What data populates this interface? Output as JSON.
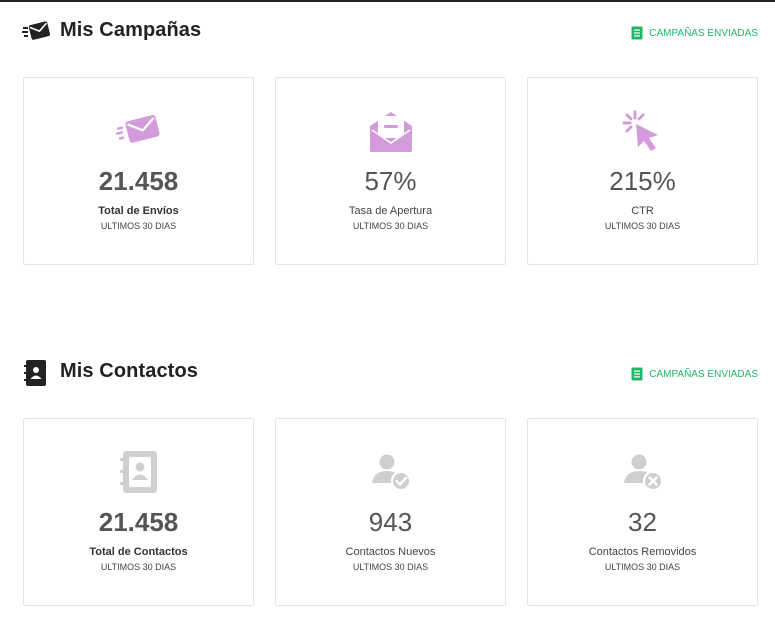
{
  "campaigns": {
    "title": "Mis Campañas",
    "link_label": "CAMPAÑAS ENVIADAS",
    "cards": [
      {
        "value": "21.458",
        "label": "Total de Envíos",
        "sub": "ULTIMOS 30 DIAS",
        "icon": "sent-envelope-icon"
      },
      {
        "value": "57%",
        "label": "Tasa de Apertura",
        "sub": "ULTIMOS 30 DIAS",
        "icon": "open-envelope-icon"
      },
      {
        "value": "215%",
        "label": "CTR",
        "sub": "ULTIMOS 30 DIAS",
        "icon": "click-cursor-icon"
      }
    ]
  },
  "contacts": {
    "title": "Mis Contactos",
    "link_label": "CAMPAÑAS ENVIADAS",
    "cards": [
      {
        "value": "21.458",
        "label": "Total de Contactos",
        "sub": "ULTIMOS 30 DIAS",
        "icon": "address-book-icon"
      },
      {
        "value": "943",
        "label": "Contactos Nuevos",
        "sub": "ULTIMOS 30 DIAS",
        "icon": "user-check-icon"
      },
      {
        "value": "32",
        "label": "Contactos Removidos",
        "sub": "ULTIMOS 30 DIAS",
        "icon": "user-remove-icon"
      }
    ]
  },
  "colors": {
    "accent_purple": "#d39bdb",
    "accent_green": "#1fb866",
    "icon_gray": "#cfcfcf",
    "title_dark": "#222222"
  }
}
